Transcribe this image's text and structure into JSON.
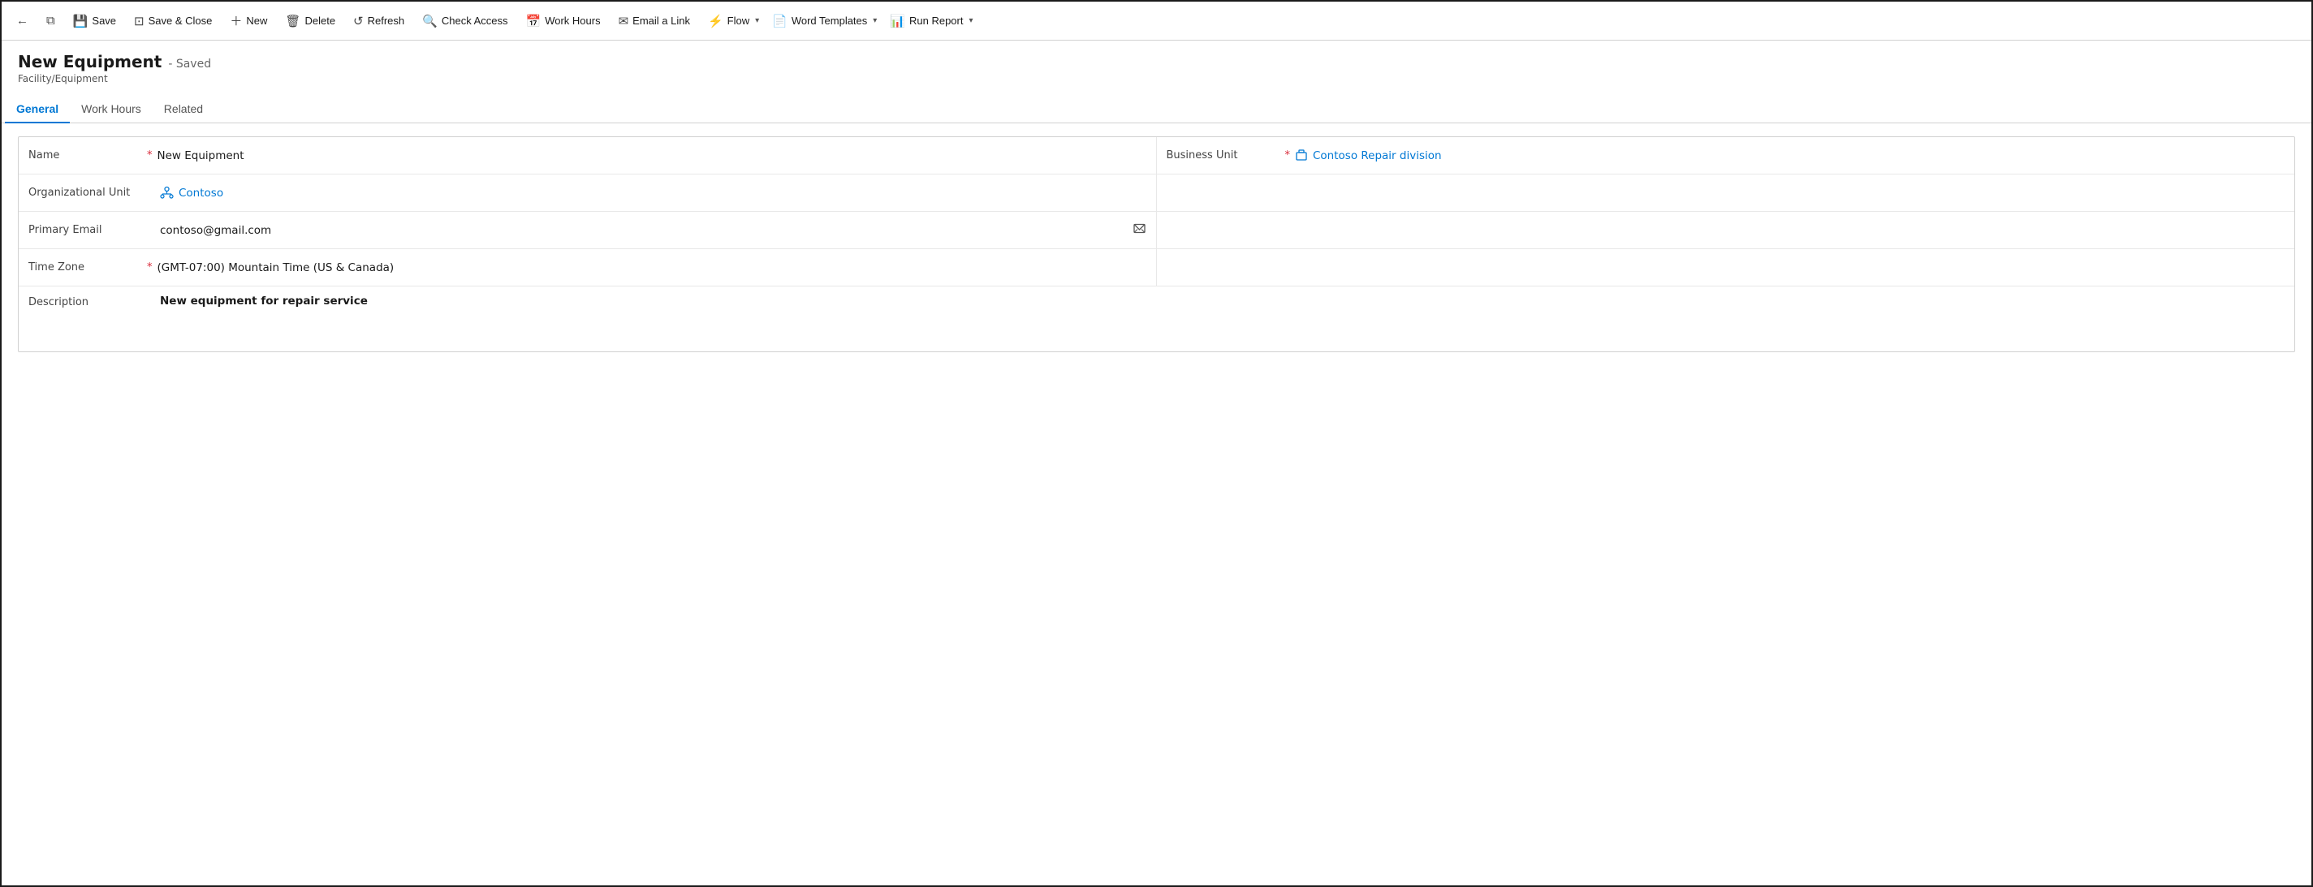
{
  "toolbar": {
    "back_icon": "←",
    "window_icon": "⧉",
    "save_label": "Save",
    "save_close_label": "Save & Close",
    "new_label": "New",
    "delete_label": "Delete",
    "refresh_label": "Refresh",
    "check_access_label": "Check Access",
    "work_hours_label": "Work Hours",
    "email_link_label": "Email a Link",
    "flow_label": "Flow",
    "word_templates_label": "Word Templates",
    "run_report_label": "Run Report"
  },
  "page": {
    "title": "New Equipment",
    "saved_status": "- Saved",
    "subtitle": "Facility/Equipment"
  },
  "tabs": [
    {
      "label": "General",
      "active": true
    },
    {
      "label": "Work Hours",
      "active": false
    },
    {
      "label": "Related",
      "active": false
    }
  ],
  "form": {
    "name_label": "Name",
    "name_value": "New Equipment",
    "business_unit_label": "Business Unit",
    "business_unit_value": "Contoso Repair division",
    "org_unit_label": "Organizational Unit",
    "org_unit_value": "Contoso",
    "primary_email_label": "Primary Email",
    "primary_email_value": "contoso@gmail.com",
    "time_zone_label": "Time Zone",
    "time_zone_value": "(GMT-07:00) Mountain Time (US & Canada)",
    "description_label": "Description",
    "description_value": "New equipment for repair service"
  }
}
